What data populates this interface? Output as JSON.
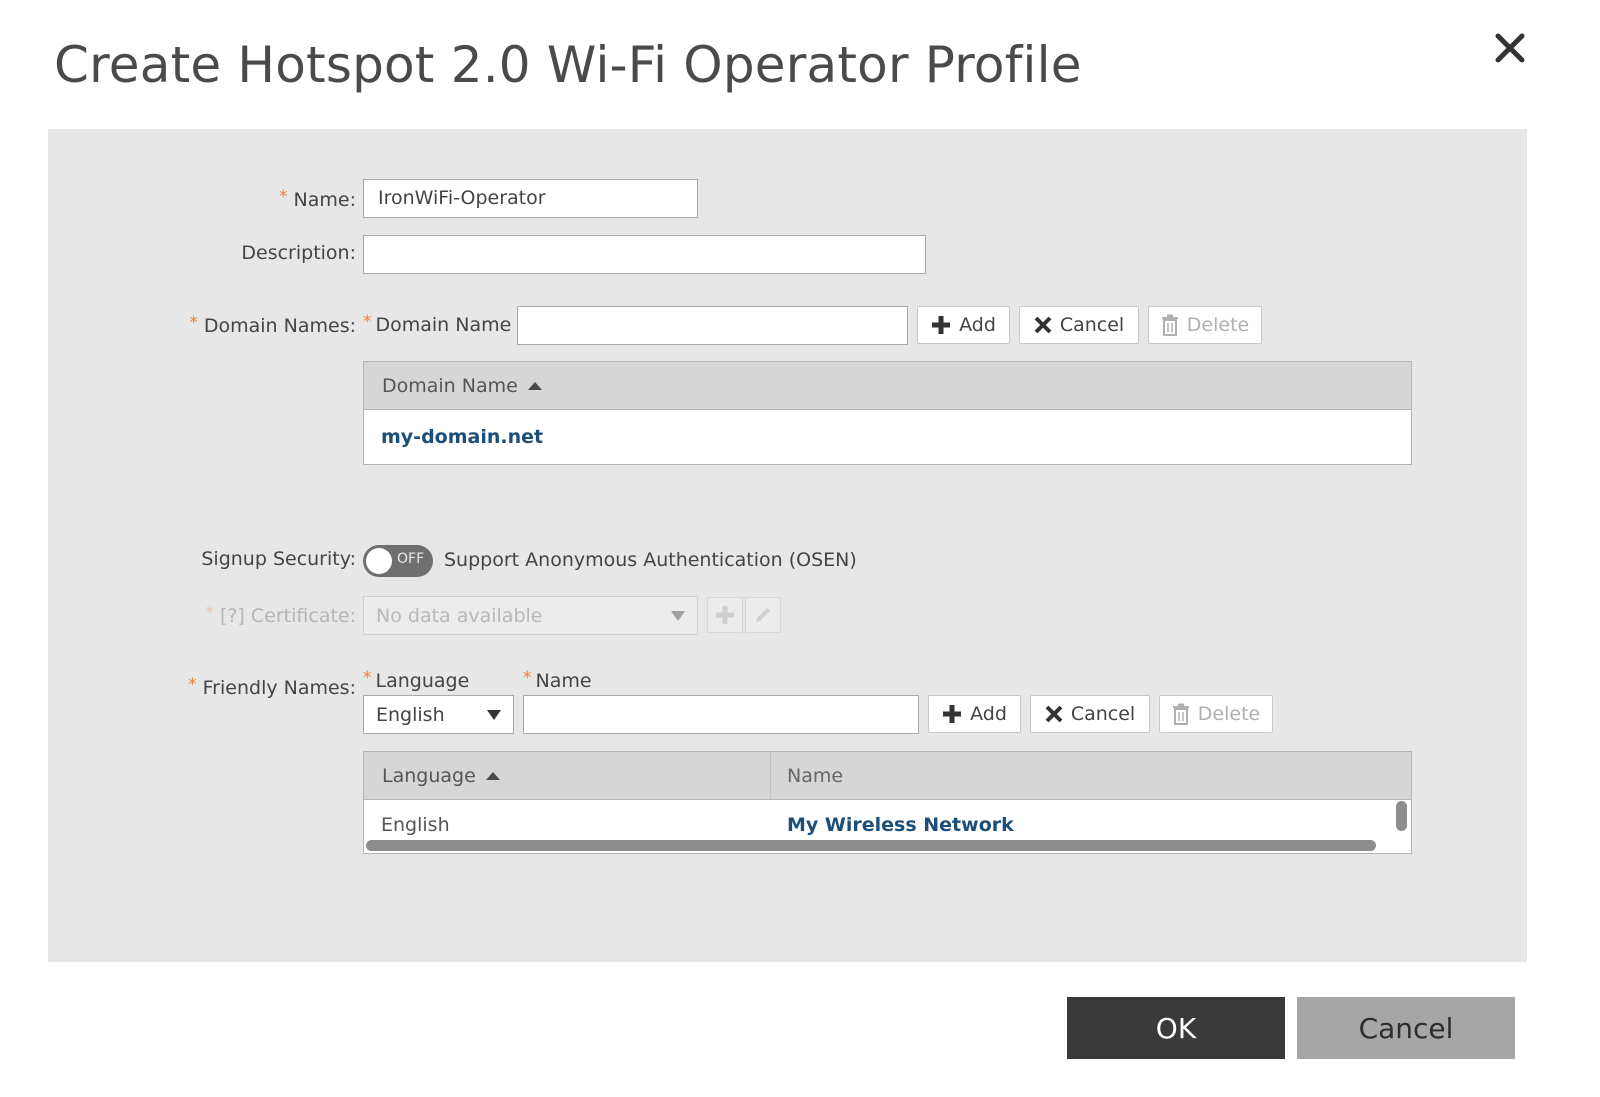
{
  "dialog": {
    "title": "Create Hotspot 2.0 Wi-Fi Operator Profile",
    "close_icon": "close-icon"
  },
  "form": {
    "name": {
      "label": "Name:",
      "required": "*",
      "value": "IronWiFi-Operator"
    },
    "description": {
      "label": "Description:",
      "value": ""
    },
    "domain_names": {
      "label": "Domain Names:",
      "required": "*",
      "input_label": "Domain Name",
      "input_value": "",
      "add_label": "Add",
      "cancel_label": "Cancel",
      "delete_label": "Delete",
      "table": {
        "header": "Domain Name",
        "rows": [
          "my-domain.net"
        ]
      }
    },
    "signup_security": {
      "label": "Signup Security:",
      "toggle_state": "OFF",
      "toggle_text": "Support Anonymous Authentication (OSEN)"
    },
    "certificate": {
      "required": "*",
      "help": "[?]",
      "label": "Certificate:",
      "placeholder": "No data available"
    },
    "friendly_names": {
      "label": "Friendly Names:",
      "required": "*",
      "language_label": "Language",
      "name_label": "Name",
      "language_value": "English",
      "name_value": "",
      "add_label": "Add",
      "cancel_label": "Cancel",
      "delete_label": "Delete",
      "table": {
        "headers": [
          "Language",
          "Name"
        ],
        "rows": [
          {
            "language": "English",
            "name": "My Wireless Network"
          }
        ]
      }
    }
  },
  "footer": {
    "ok_label": "OK",
    "cancel_label": "Cancel"
  },
  "colors": {
    "accent_required": "#f07d33",
    "link": "#1b4f7a",
    "panel_bg": "#e7e7e7",
    "ok_bg": "#3a3a3a",
    "cancel_bg": "#a6a6a6"
  }
}
